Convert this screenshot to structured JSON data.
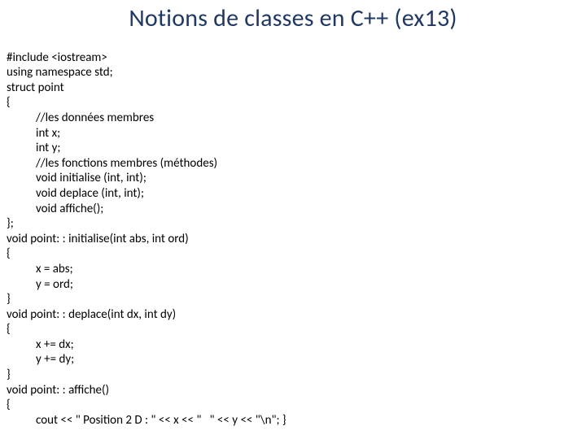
{
  "title": "Notions de classes en C++ (ex13)",
  "code": {
    "l01": "#include <iostream>",
    "l02": "using namespace std;",
    "l03": "struct point",
    "l04": "{",
    "l05": "//les données membres",
    "l06": "int x;",
    "l07": "int y;",
    "l08": "//les fonctions membres (méthodes)",
    "l09": "void initialise (int, int);",
    "l10": "void deplace (int, int);",
    "l11": "void affiche();",
    "l12": "};",
    "l13": "void point: : initialise(int abs, int ord)",
    "l14": "{",
    "l15": "x = abs;",
    "l16": "y = ord;",
    "l17": "}",
    "l18": "void point: : deplace(int dx, int dy)",
    "l19": "{",
    "l20": "x += dx;",
    "l21": "y += dy;",
    "l22": "}",
    "l23": "void point: : affiche()",
    "l24": "{",
    "l25": "cout << \" Position 2 D : \" << x << \"   \" << y << \"\\n\"; }"
  }
}
